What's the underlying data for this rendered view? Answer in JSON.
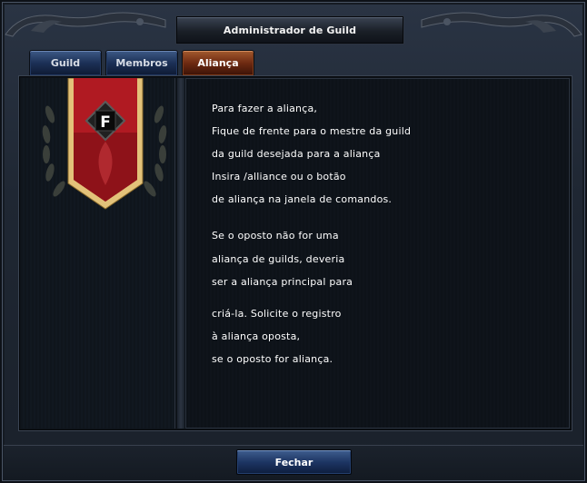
{
  "window": {
    "title": "Administrador de Guild"
  },
  "tabs": [
    {
      "label": "Guild",
      "active": false
    },
    {
      "label": "Membros",
      "active": false
    },
    {
      "label": "Aliança",
      "active": true
    }
  ],
  "emblem": {
    "letter": "F",
    "banner_color": "#b01a22",
    "trim_color": "#e3c27a"
  },
  "instructions": {
    "lines": [
      "Para fazer a aliança,",
      "Fique de frente para o mestre da guild",
      "da guild desejada para a aliança",
      "Insira /alliance ou o botão",
      "de aliança na janela de comandos.",
      "Se o oposto não for uma",
      "aliança de guilds, deveria",
      "ser a aliança principal para",
      "criá-la. Solicite o registro",
      "à aliança oposta,",
      "se o oposto for aliança."
    ]
  },
  "footer": {
    "close_label": "Fechar"
  }
}
